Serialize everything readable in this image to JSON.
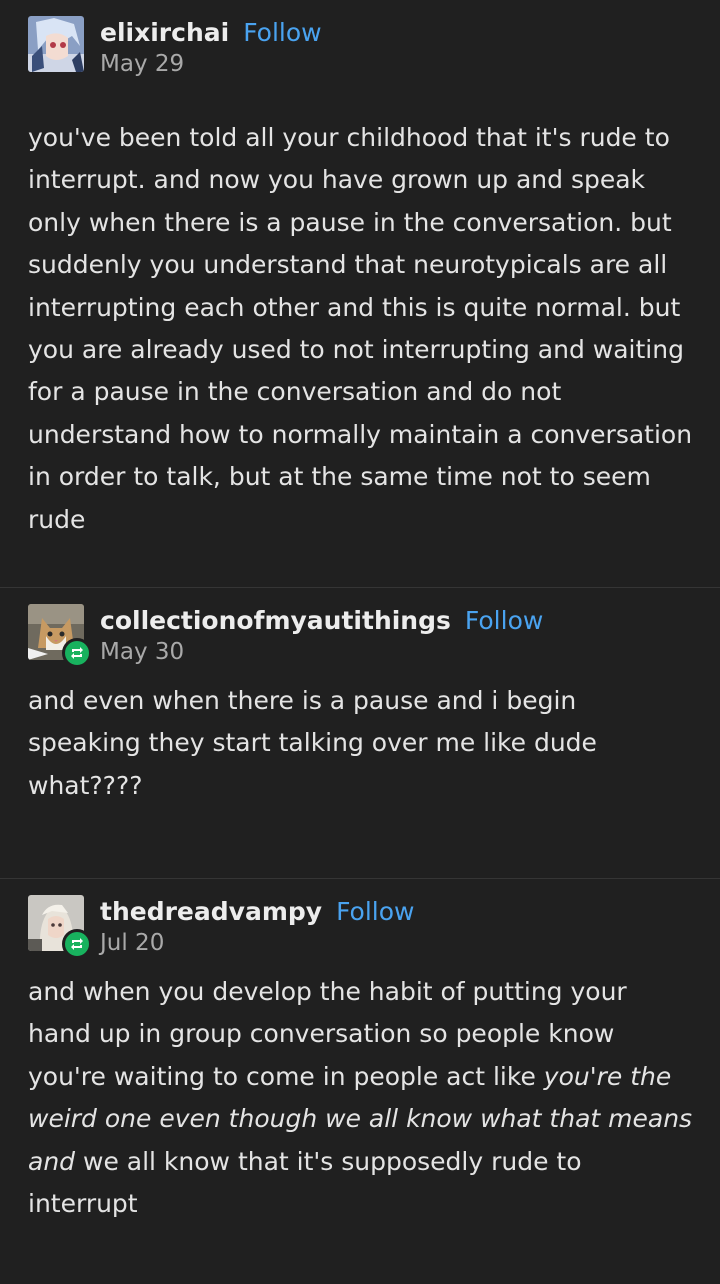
{
  "posts": [
    {
      "username": "elixirchai",
      "follow_label": "Follow",
      "date": "May 29",
      "reblog": false,
      "avatar_icon": "anime-character-avatar",
      "text": "you've been told all your childhood that it's rude to interrupt. and now you have grown up and speak only when there is a pause in the conversation. but suddenly you understand that neurotypicals are all interrupting each other and this is quite normal. but you are already used to not interrupting and waiting for a pause in the conversation and do not understand how to normally maintain a conversation in order to talk, but at the same time not to seem rude"
    },
    {
      "username": "collectionofmyautithings",
      "follow_label": "Follow",
      "date": "May 30",
      "reblog": true,
      "avatar_icon": "cat-avatar",
      "text": "and even when there is a pause and i begin speaking they start talking over me like dude what????"
    },
    {
      "username": "thedreadvampy",
      "follow_label": "Follow",
      "date": "Jul 20",
      "reblog": true,
      "avatar_icon": "person-avatar",
      "text_part1": "and when you develop the habit of putting your hand up in group conversation so people know you're waiting to come in people act like ",
      "text_italic": "you're the weird one even though we all know what that means and",
      "text_part2": " we all know that it's supposedly rude to interrupt"
    }
  ],
  "colors": {
    "background": "#202020",
    "follow": "#4aa3f0",
    "reblog_badge": "#18b25e",
    "divider": "#353535"
  }
}
